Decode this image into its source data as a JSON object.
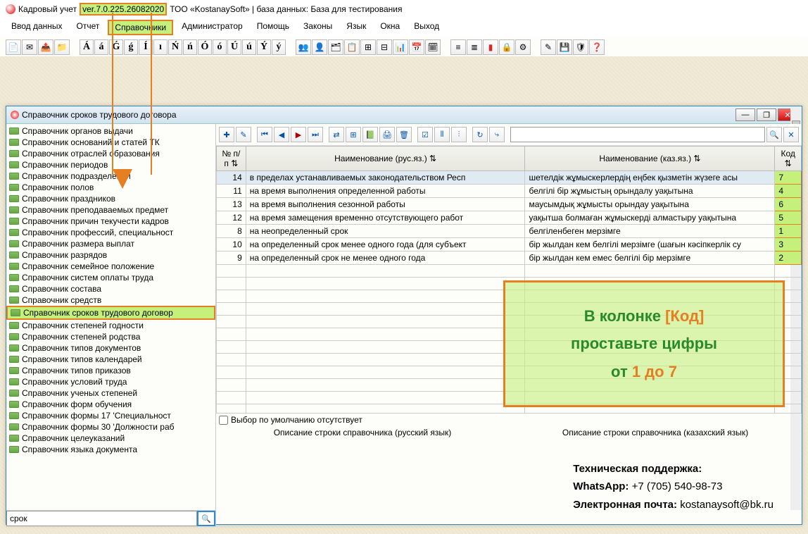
{
  "title": {
    "prefix": "Кадровый учет",
    "version": "ver.7.0.225.26082020",
    "suffix": "ТОО «KostanaySoft» | база данных: База для тестирования"
  },
  "menu": [
    "Ввод данных",
    "Отчет",
    "Справочники",
    "Администратор",
    "Помощь",
    "Законы",
    "Язык",
    "Окна",
    "Выход"
  ],
  "menu_highlight_index": 2,
  "chars": [
    "Á",
    "á",
    "Ǵ",
    "ǵ",
    "Í",
    "ı",
    "Ń",
    "ń",
    "Ó",
    "ó",
    "Ú",
    "ú",
    "Ý",
    "ý"
  ],
  "child_window": {
    "title": "Справочник сроков трудового договора"
  },
  "tree_items": [
    "Справочник органов выдачи",
    "Справочник оснований и статей ТК",
    "Справочник отраслей образования",
    "Справочник периодов",
    "Справочник подразделений",
    "Справочник полов",
    "Справочник праздников",
    "Справочник преподаваемых предмет",
    "Справочник причин текучести кадров",
    "Справочник профессий, специальност",
    "Справочник размера выплат",
    "Справочник разрядов",
    "Справочник семейное положение",
    "Справочник систем оплаты труда",
    "Справочник состава",
    "Справочник средств",
    "Справочник сроков трудового договор",
    "Справочник степеней годности",
    "Справочник степеней родства",
    "Справочник типов документов",
    "Справочник типов календарей",
    "Справочник типов приказов",
    "Справочник условий труда",
    "Справочник ученых степеней",
    "Справочник форм обучения",
    "Справочник формы 17 'Специальност",
    "Справочник формы 30 'Должности раб",
    "Справочник целеуказаний",
    "Справочник языка документа"
  ],
  "tree_selected_index": 16,
  "filter_value": "срок",
  "grid": {
    "headers": {
      "num": "№ п/п",
      "rus": "Наименование (рус.яз.)",
      "kaz": "Наименование (каз.яз.)",
      "kod": "Код"
    },
    "rows": [
      {
        "num": "14",
        "rus": "в пределах устанавливаемых законодательством Респ",
        "kaz": "шетелдік жұмыскерлердің еңбек қызметін жүзеге асы",
        "kod": "7"
      },
      {
        "num": "11",
        "rus": "на время выполнения определенной работы",
        "kaz": "белгілі бір жұмыстың орындалу уақытына",
        "kod": "4"
      },
      {
        "num": "13",
        "rus": "на время выполнения сезонной работы",
        "kaz": "маусымдық жұмысты орындау уақытына",
        "kod": "6"
      },
      {
        "num": "12",
        "rus": "на время замещения временно отсутствующего работ",
        "kaz": "уақытша болмаған жұмыскерді алмастыру уақытына",
        "kod": "5"
      },
      {
        "num": "8",
        "rus": "на неопределенный срок",
        "kaz": "белгіленбеген мерзімге",
        "kod": "1"
      },
      {
        "num": "10",
        "rus": "на определенный срок менее одного года (для субъект",
        "kaz": "бір жылдан кем белгілі мерзімге (шағын кәсіпкерлік су",
        "kod": "3"
      },
      {
        "num": "9",
        "rus": "на определенный срок не менее одного года",
        "kaz": "бір жылдан кем емес белгілі бір мерзімге",
        "kod": "2"
      }
    ],
    "selected_row": 0
  },
  "default_label": "Выбор по умолчанию отсутствует",
  "desc_headers": {
    "rus": "Описание строки справочника (русский язык)",
    "kaz": "Описание строки справочника (казахский язык)"
  },
  "annotation": {
    "line1_a": "В колонке ",
    "line1_b": "[Код]",
    "line2": "проставьте цифры",
    "line3_a": "от ",
    "line3_b": "1 до 7"
  },
  "support": {
    "title": "Техническая поддержка:",
    "whatsapp_lbl": "WhatsApp: ",
    "whatsapp_val": "+7 (705) 540-98-73",
    "email_lbl": "Электронная почта:  ",
    "email_val": "kostanaysoft@bk.ru"
  }
}
